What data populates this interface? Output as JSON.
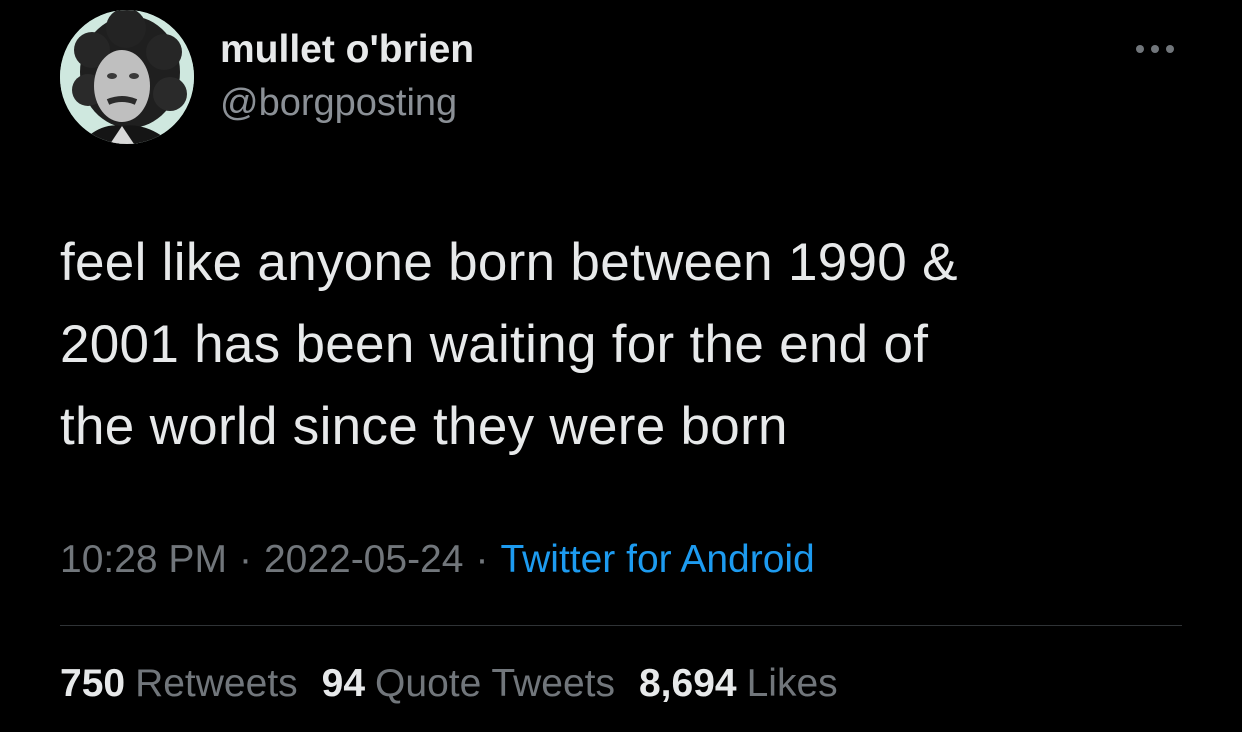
{
  "user": {
    "display_name": "mullet o'brien",
    "handle": "@borgposting",
    "avatar_icon": "profile-photo"
  },
  "more_icon": "more-horizontal-icon",
  "tweet": {
    "text_lines": [
      "feel like anyone born between 1990 &",
      "2001 has been waiting for the end of",
      "the world since they were born"
    ]
  },
  "meta": {
    "time": "10:28 PM",
    "separator": "·",
    "date": "2022-05-24",
    "source": "Twitter for Android"
  },
  "stats": {
    "retweets_count": "750",
    "retweets_label": "Retweets",
    "quotes_count": "94",
    "quotes_label": "Quote Tweets",
    "likes_count": "8,694",
    "likes_label": "Likes"
  },
  "colors": {
    "background": "#000000",
    "primary_text": "#e7e9ea",
    "secondary_text": "#71767b",
    "link": "#1d9bf0",
    "divider": "#2f3336",
    "avatar_bg": "#cfe8df"
  }
}
